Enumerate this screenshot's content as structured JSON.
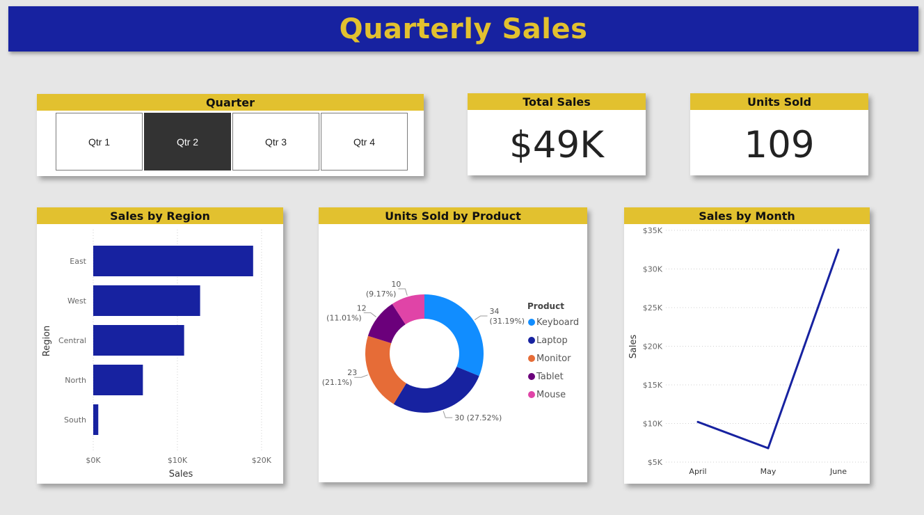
{
  "header": {
    "title": "Quarterly Sales"
  },
  "slicer": {
    "title": "Quarter",
    "options": [
      "Qtr 1",
      "Qtr 2",
      "Qtr 3",
      "Qtr 4"
    ],
    "selected": "Qtr 2"
  },
  "kpis": {
    "total_sales": {
      "title": "Total Sales",
      "value": "$49K"
    },
    "units_sold": {
      "title": "Units Sold",
      "value": "109"
    }
  },
  "colors": {
    "accent_yellow": "#e2c12f",
    "brand_blue": "#1722a0",
    "background": "#e6e6e6"
  },
  "chart_data": [
    {
      "type": "bar",
      "orientation": "horizontal",
      "title": "Sales by Region",
      "xlabel": "Sales",
      "ylabel": "Region",
      "categories": [
        "East",
        "West",
        "Central",
        "North",
        "South"
      ],
      "values": [
        19000,
        12700,
        10800,
        5900,
        600
      ],
      "xlim": [
        0,
        21000
      ],
      "xticks": [
        0,
        10000,
        20000
      ],
      "xtick_labels": [
        "$0K",
        "$10K",
        "$20K"
      ],
      "grid": true,
      "color": "#1722a0"
    },
    {
      "type": "pie",
      "variant": "donut",
      "title": "Units Sold by Product",
      "legend_title": "Product",
      "legend_position": "right",
      "slices": [
        {
          "name": "Keyboard",
          "value": 34,
          "label": "34",
          "pct": "(31.19%)",
          "color": "#118dff"
        },
        {
          "name": "Laptop",
          "value": 30,
          "label": "30 (27.52%)",
          "pct": "",
          "color": "#1722a0"
        },
        {
          "name": "Monitor",
          "value": 23,
          "label": "23",
          "pct": "(21.1%)",
          "color": "#e66c37"
        },
        {
          "name": "Tablet",
          "value": 12,
          "label": "12",
          "pct": "(11.01%)",
          "color": "#6b007b"
        },
        {
          "name": "Mouse",
          "value": 10,
          "label": "10",
          "pct": "(9.17%)",
          "color": "#e044a7"
        }
      ]
    },
    {
      "type": "line",
      "title": "Sales by Month",
      "xlabel": "",
      "ylabel": "Sales",
      "x": [
        "April",
        "May",
        "June"
      ],
      "values": [
        10200,
        6800,
        32500
      ],
      "ylim": [
        5000,
        35000
      ],
      "yticks": [
        5000,
        10000,
        15000,
        20000,
        25000,
        30000,
        35000
      ],
      "ytick_labels": [
        "$5K",
        "$10K",
        "$15K",
        "$20K",
        "$25K",
        "$30K",
        "$35K"
      ],
      "grid": true,
      "color": "#1722a0"
    }
  ]
}
